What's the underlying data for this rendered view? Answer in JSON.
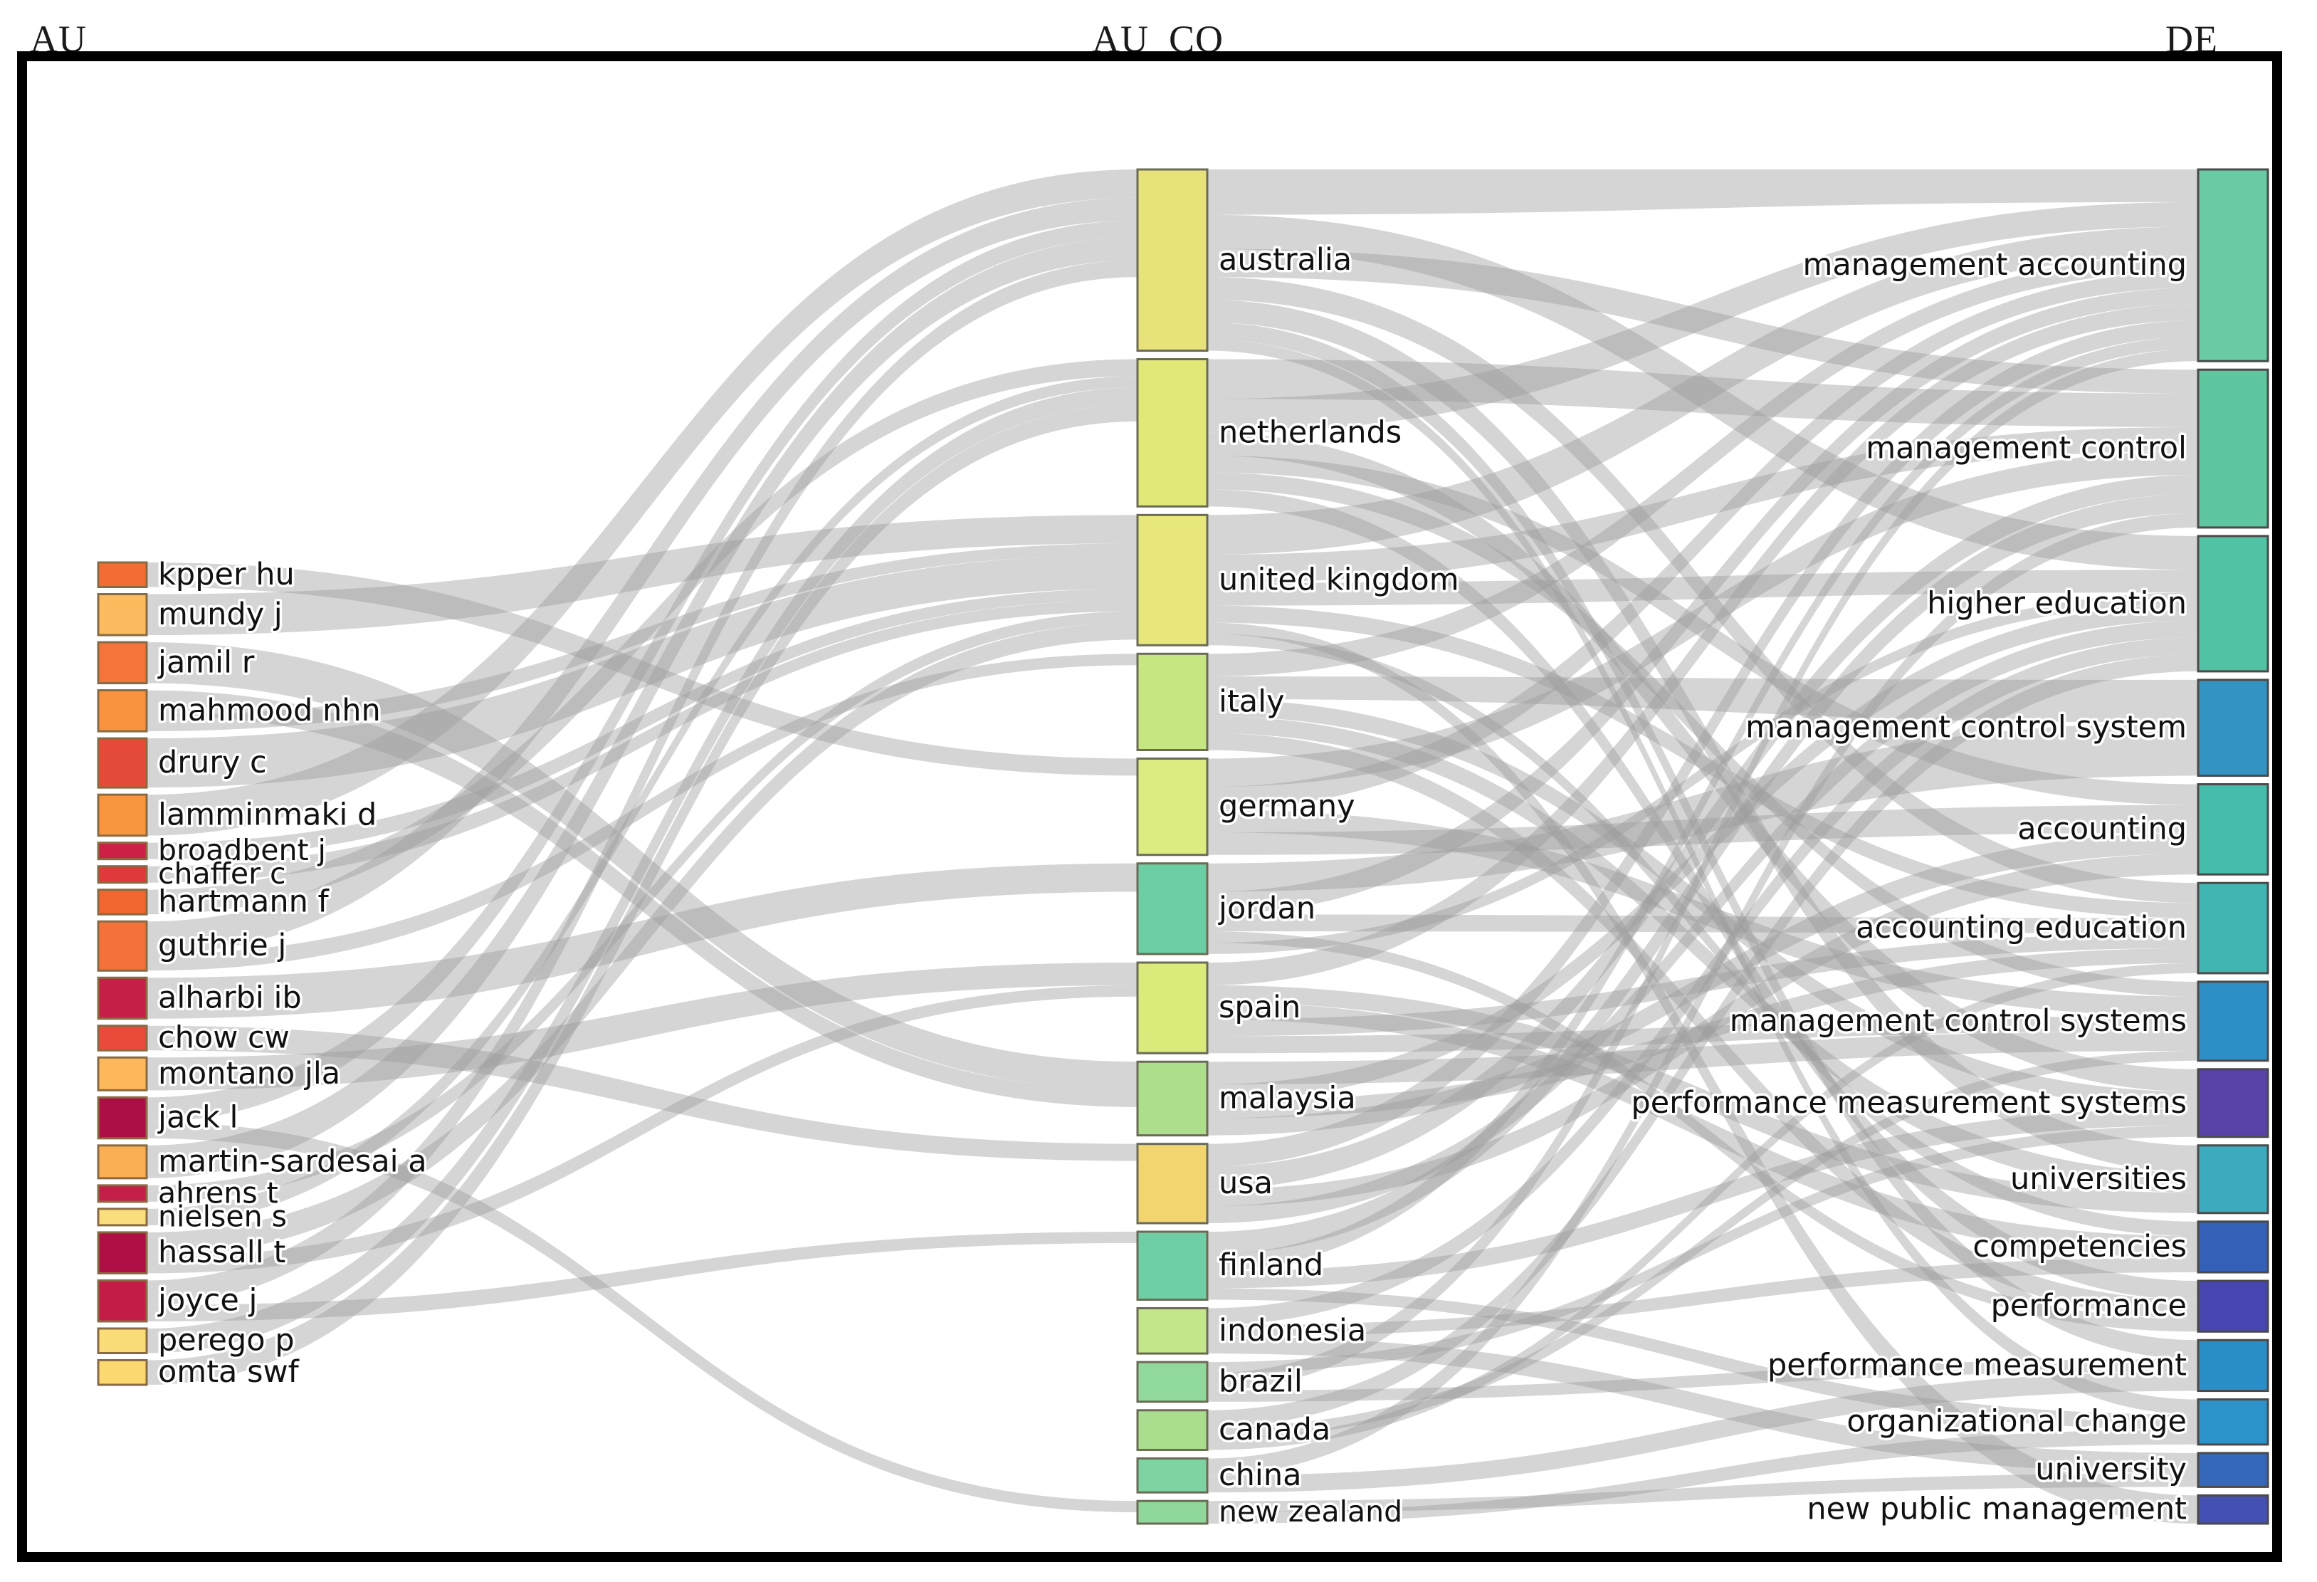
{
  "headers": {
    "left": "AU",
    "middle": "AU_CO",
    "right": "DE"
  },
  "chart_data": {
    "type": "sankey",
    "title": "",
    "columns": [
      "AU",
      "AU_CO",
      "DE"
    ],
    "nodes": {
      "AU": [
        {
          "label": "kpper hu",
          "value": 3,
          "color": "#f26d33"
        },
        {
          "label": "mundy j",
          "value": 5,
          "color": "#fcbb5e"
        },
        {
          "label": "jamil r",
          "value": 5,
          "color": "#f4743a"
        },
        {
          "label": "mahmood nhn",
          "value": 5,
          "color": "#f99340"
        },
        {
          "label": "drury c",
          "value": 6,
          "color": "#e64a38"
        },
        {
          "label": "lamminmaki d",
          "value": 5,
          "color": "#f9953f"
        },
        {
          "label": "broadbent j",
          "value": 2,
          "color": "#cc2046"
        },
        {
          "label": "chaffer c",
          "value": 2,
          "color": "#e03a3c"
        },
        {
          "label": "hartmann f",
          "value": 3,
          "color": "#f2662f"
        },
        {
          "label": "guthrie j",
          "value": 6,
          "color": "#f4713a"
        },
        {
          "label": "alharbi ib",
          "value": 5,
          "color": "#c51f48"
        },
        {
          "label": "chow cw",
          "value": 3,
          "color": "#ea4a3a"
        },
        {
          "label": "montano jla",
          "value": 4,
          "color": "#fcb85b"
        },
        {
          "label": "jack l",
          "value": 5,
          "color": "#ab0f45"
        },
        {
          "label": "martin-sardesai a",
          "value": 4,
          "color": "#fbaf54"
        },
        {
          "label": "ahrens t",
          "value": 2,
          "color": "#c41f48"
        },
        {
          "label": "nielsen s",
          "value": 2,
          "color": "#fadd7c"
        },
        {
          "label": "hassall t",
          "value": 5,
          "color": "#ae0f45"
        },
        {
          "label": "joyce j",
          "value": 5,
          "color": "#c31d47"
        },
        {
          "label": "perego p",
          "value": 3,
          "color": "#fadc79"
        },
        {
          "label": "omta swf",
          "value": 3,
          "color": "#fbd870"
        }
      ],
      "AU_CO": [
        {
          "label": "australia",
          "value": 32,
          "color": "#e8e27a"
        },
        {
          "label": "netherlands",
          "value": 26,
          "color": "#e2e878"
        },
        {
          "label": "united kingdom",
          "value": 23,
          "color": "#e7e77c"
        },
        {
          "label": "italy",
          "value": 17,
          "color": "#c6e682"
        },
        {
          "label": "germany",
          "value": 17,
          "color": "#dcec80"
        },
        {
          "label": "jordan",
          "value": 16,
          "color": "#6ccea5"
        },
        {
          "label": "spain",
          "value": 16,
          "color": "#dcea7c"
        },
        {
          "label": "malaysia",
          "value": 13,
          "color": "#adde8c"
        },
        {
          "label": "usa",
          "value": 14,
          "color": "#f2d56e"
        },
        {
          "label": "finland",
          "value": 12,
          "color": "#6ecfa7"
        },
        {
          "label": "indonesia",
          "value": 8,
          "color": "#c4e68a"
        },
        {
          "label": "brazil",
          "value": 7,
          "color": "#91d89c"
        },
        {
          "label": "canada",
          "value": 7,
          "color": "#aadd8d"
        },
        {
          "label": "china",
          "value": 6,
          "color": "#7ed3a2"
        },
        {
          "label": "new zealand",
          "value": 4,
          "color": "#8fd79a"
        }
      ],
      "DE": [
        {
          "label": "management accounting",
          "value": 34,
          "color": "#68cba4"
        },
        {
          "label": "management control",
          "value": 28,
          "color": "#5ec7a0"
        },
        {
          "label": "higher education",
          "value": 24,
          "color": "#52c2a4"
        },
        {
          "label": "management control system",
          "value": 17,
          "color": "#3394c4"
        },
        {
          "label": "accounting",
          "value": 16,
          "color": "#45bcac"
        },
        {
          "label": "accounting education",
          "value": 16,
          "color": "#41b5b2"
        },
        {
          "label": "management control systems",
          "value": 14,
          "color": "#2e8fc6"
        },
        {
          "label": "performance measurement systems",
          "value": 12,
          "color": "#5a43a8"
        },
        {
          "label": "universities",
          "value": 12,
          "color": "#3cabbd"
        },
        {
          "label": "competencies",
          "value": 9,
          "color": "#3560b8"
        },
        {
          "label": "performance",
          "value": 9,
          "color": "#4746b0"
        },
        {
          "label": "performance measurement",
          "value": 9,
          "color": "#2a8fc9"
        },
        {
          "label": "organizational change",
          "value": 8,
          "color": "#2b92ca"
        },
        {
          "label": "university",
          "value": 6,
          "color": "#3568bb"
        },
        {
          "label": "new public management",
          "value": 5,
          "color": "#4550b4"
        }
      ]
    },
    "links_au_auco": [
      [
        "kpper hu",
        "germany",
        3
      ],
      [
        "mundy j",
        "united kingdom",
        5
      ],
      [
        "jamil r",
        "malaysia",
        5
      ],
      [
        "mahmood nhn",
        "malaysia",
        3
      ],
      [
        "mahmood nhn",
        "united kingdom",
        2
      ],
      [
        "drury c",
        "united kingdom",
        6
      ],
      [
        "lamminmaki d",
        "australia",
        5
      ],
      [
        "broadbent j",
        "united kingdom",
        2
      ],
      [
        "chaffer c",
        "united kingdom",
        2
      ],
      [
        "hartmann f",
        "netherlands",
        3
      ],
      [
        "guthrie j",
        "australia",
        4
      ],
      [
        "guthrie j",
        "italy",
        2
      ],
      [
        "alharbi ib",
        "jordan",
        5
      ],
      [
        "chow cw",
        "usa",
        3
      ],
      [
        "montano jla",
        "spain",
        4
      ],
      [
        "jack l",
        "australia",
        3
      ],
      [
        "jack l",
        "new zealand",
        2
      ],
      [
        "martin-sardesai a",
        "australia",
        4
      ],
      [
        "ahrens t",
        "united kingdom",
        2
      ],
      [
        "nielsen s",
        "netherlands",
        2
      ],
      [
        "hassall t",
        "united kingdom",
        3
      ],
      [
        "hassall t",
        "spain",
        2
      ],
      [
        "joyce j",
        "australia",
        3
      ],
      [
        "joyce j",
        "finland",
        2
      ],
      [
        "perego p",
        "netherlands",
        3
      ],
      [
        "omta swf",
        "netherlands",
        3
      ]
    ],
    "links_auco_de": [
      [
        "australia",
        "management accounting",
        8
      ],
      [
        "australia",
        "higher education",
        6
      ],
      [
        "australia",
        "management control",
        5
      ],
      [
        "australia",
        "accounting education",
        4
      ],
      [
        "australia",
        "universities",
        4
      ],
      [
        "australia",
        "performance measurement",
        3
      ],
      [
        "australia",
        "organizational change",
        2
      ],
      [
        "netherlands",
        "management control",
        7
      ],
      [
        "netherlands",
        "management accounting",
        6
      ],
      [
        "netherlands",
        "performance measurement systems",
        4
      ],
      [
        "netherlands",
        "accounting",
        3
      ],
      [
        "netherlands",
        "management control systems",
        3
      ],
      [
        "netherlands",
        "performance",
        3
      ],
      [
        "united kingdom",
        "management accounting",
        7
      ],
      [
        "united kingdom",
        "management control",
        5
      ],
      [
        "united kingdom",
        "higher education",
        4
      ],
      [
        "united kingdom",
        "accounting education",
        3
      ],
      [
        "united kingdom",
        "new public management",
        2
      ],
      [
        "united kingdom",
        "competencies",
        2
      ],
      [
        "italy",
        "management accounting",
        4
      ],
      [
        "italy",
        "management control system",
        4
      ],
      [
        "italy",
        "performance measurement systems",
        3
      ],
      [
        "italy",
        "universities",
        3
      ],
      [
        "italy",
        "performance",
        3
      ],
      [
        "germany",
        "management control",
        5
      ],
      [
        "germany",
        "management accounting",
        4
      ],
      [
        "germany",
        "management control systems",
        4
      ],
      [
        "germany",
        "accounting",
        4
      ],
      [
        "jordan",
        "management control system",
        5
      ],
      [
        "jordan",
        "management accounting",
        4
      ],
      [
        "jordan",
        "accounting education",
        3
      ],
      [
        "jordan",
        "performance",
        2
      ],
      [
        "jordan",
        "higher education",
        2
      ],
      [
        "spain",
        "management accounting",
        4
      ],
      [
        "spain",
        "universities",
        3
      ],
      [
        "spain",
        "competencies",
        3
      ],
      [
        "spain",
        "accounting education",
        3
      ],
      [
        "spain",
        "management control systems",
        3
      ],
      [
        "malaysia",
        "management control systems",
        4
      ],
      [
        "malaysia",
        "higher education",
        3
      ],
      [
        "malaysia",
        "accounting education",
        3
      ],
      [
        "malaysia",
        "accounting",
        3
      ],
      [
        "usa",
        "management accounting",
        4
      ],
      [
        "usa",
        "management control",
        4
      ],
      [
        "usa",
        "accounting",
        3
      ],
      [
        "usa",
        "higher education",
        3
      ],
      [
        "finland",
        "management control",
        4
      ],
      [
        "finland",
        "management accounting",
        3
      ],
      [
        "finland",
        "performance measurement systems",
        3
      ],
      [
        "finland",
        "organizational change",
        2
      ],
      [
        "indonesia",
        "higher education",
        3
      ],
      [
        "indonesia",
        "competencies",
        2
      ],
      [
        "indonesia",
        "university",
        3
      ],
      [
        "brazil",
        "performance measurement systems",
        2
      ],
      [
        "brazil",
        "management accounting",
        3
      ],
      [
        "brazil",
        "performance measurement",
        2
      ],
      [
        "canada",
        "higher education",
        3
      ],
      [
        "canada",
        "management control systems",
        2
      ],
      [
        "canada",
        "accounting education",
        2
      ],
      [
        "china",
        "management control",
        3
      ],
      [
        "china",
        "performance measurement",
        3
      ],
      [
        "new zealand",
        "university",
        2
      ],
      [
        "new zealand",
        "organizational change",
        2
      ]
    ],
    "legend_position": "none",
    "grid": false
  },
  "colors": {
    "flow": "#9a9a9a",
    "frame": "#000000",
    "background": "#ffffff",
    "label_text": "#111111"
  }
}
